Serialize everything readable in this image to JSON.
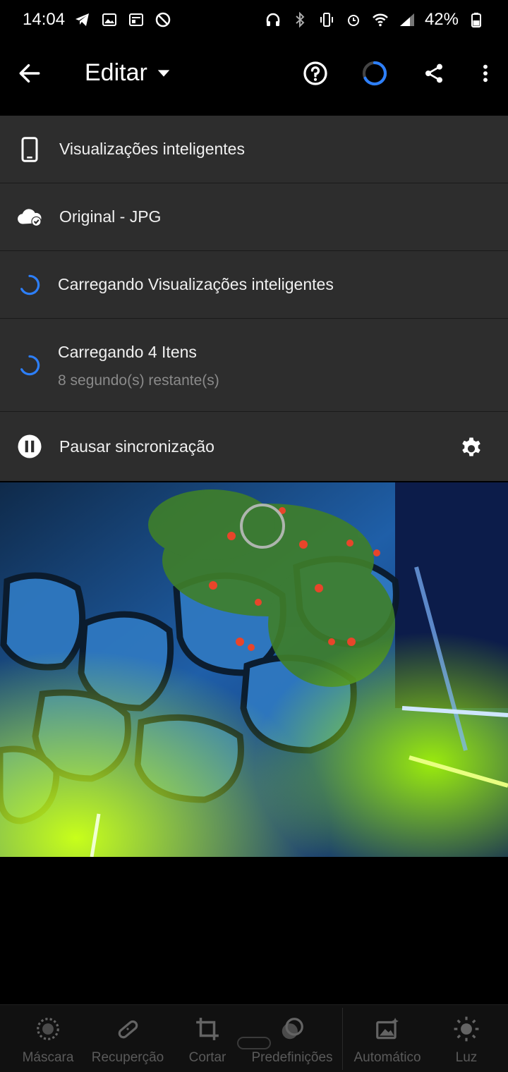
{
  "status_bar": {
    "time": "14:04",
    "battery": "42%",
    "left_icons": [
      "telegram-icon",
      "gallery-icon",
      "news-icon",
      "blocked-icon"
    ],
    "right_icons": [
      "headset-icon",
      "bluetooth-icon",
      "vibrate-icon",
      "alarm-icon",
      "wifi-icon",
      "signal-icon",
      "battery-icon"
    ]
  },
  "header": {
    "title": "Editar",
    "buttons": [
      "back-arrow-icon",
      "chevron-down-icon",
      "help-icon",
      "sync-progress-icon",
      "share-icon",
      "more-vert-icon"
    ]
  },
  "sync_panel": {
    "smart_previews": "Visualizações inteligentes",
    "original": "Original - JPG",
    "loading_previews": "Carregando Visualizações inteligentes",
    "loading_items": "Carregando 4 Itens",
    "remaining": "8 segundo(s) restante(s)",
    "pause": "Pausar sincronização"
  },
  "toolbar": {
    "items": [
      {
        "label": "Máscara",
        "icon": "mask-icon"
      },
      {
        "label": "Recuperção",
        "icon": "healing-bandage-icon"
      },
      {
        "label": "Cortar",
        "icon": "crop-icon"
      },
      {
        "label": "Predefinições",
        "icon": "presets-icon"
      },
      {
        "label": "Automático",
        "icon": "auto-image-icon"
      },
      {
        "label": "Luz",
        "icon": "sun-icon"
      }
    ]
  },
  "colors": {
    "accent": "#2d7ff9",
    "panel": "#2d2d2d",
    "background": "#000000"
  }
}
